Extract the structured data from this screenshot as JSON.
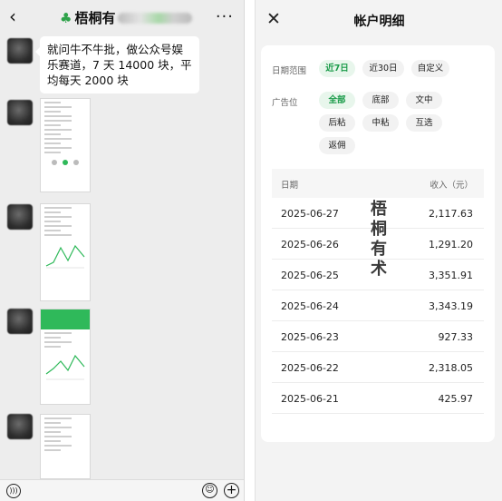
{
  "chat": {
    "title": "梧桐有",
    "message": "就问牛不牛批，做公众号娱乐赛道，7 天 14000 块，平均每天 2000 块",
    "icons": {
      "back": "chevron-left-icon",
      "more": "more-dots-icon",
      "voice": "voice-icon",
      "emoji": "emoji-icon",
      "plus": "plus-icon"
    }
  },
  "detail": {
    "title": "帐户明细",
    "date_range_label": "日期范围",
    "date_options": [
      "近7日",
      "近30日",
      "自定义"
    ],
    "date_selected": "近7日",
    "ad_slot_label": "广告位",
    "ad_slot_options": [
      "全部",
      "底部",
      "文中",
      "后粘",
      "中粘",
      "互选",
      "返佣"
    ],
    "ad_slot_selected": "全部",
    "table_headers": {
      "date": "日期",
      "income": "收入（元）"
    },
    "rows": [
      {
        "date": "2025-06-27",
        "income": "2,117.63"
      },
      {
        "date": "2025-06-26",
        "income": "1,291.20"
      },
      {
        "date": "2025-06-25",
        "income": "3,351.91"
      },
      {
        "date": "2025-06-24",
        "income": "3,343.19"
      },
      {
        "date": "2025-06-23",
        "income": "927.33"
      },
      {
        "date": "2025-06-22",
        "income": "2,318.05"
      },
      {
        "date": "2025-06-21",
        "income": "425.97"
      }
    ],
    "watermark": "梧桐有术",
    "accent_color": "#1a9b49"
  }
}
